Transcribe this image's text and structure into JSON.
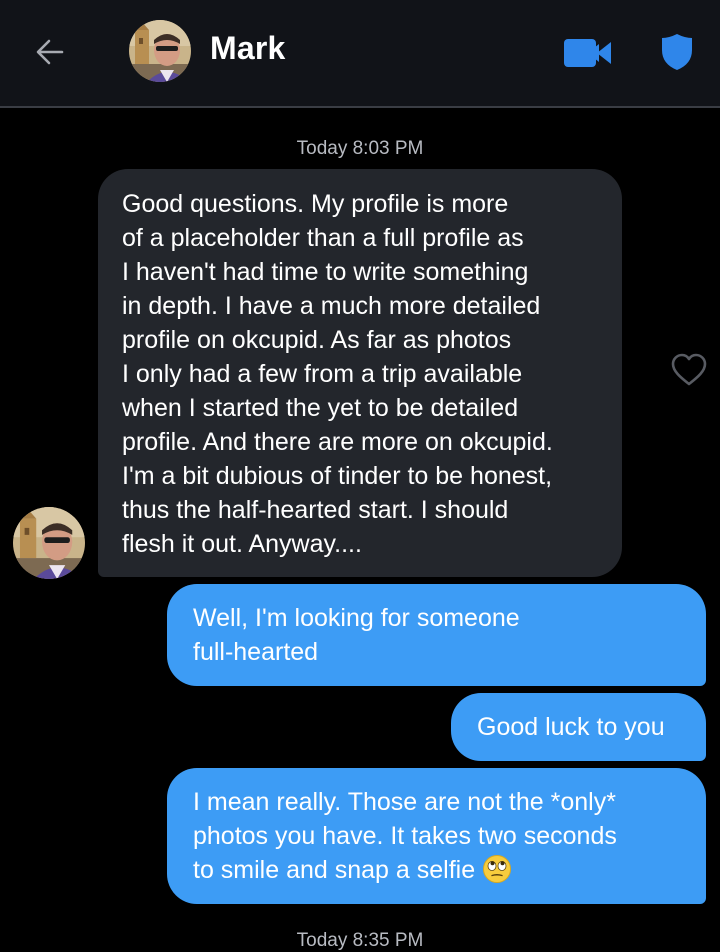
{
  "header": {
    "contact_name": "Mark",
    "back_icon": "arrow-left-icon",
    "video_icon": "video-camera-icon",
    "safety_icon": "shield-icon",
    "accent_color": "#2f86ea"
  },
  "conversation": {
    "timestamp_top": "Today 8:03 PM",
    "timestamp_bottom": "Today 8:35 PM",
    "messages": [
      {
        "direction": "incoming",
        "text": "Good questions. My profile is more\nof a placeholder than a full profile as\nI haven't had time to write something\nin depth. I have a much more detailed\nprofile on okcupid. As far as photos\nI only had a few from a trip available\nwhen I started the yet to be detailed\nprofile. And there are more on okcupid.\nI'm a bit dubious of tinder to be honest,\nthus the half-hearted start. I should\nflesh it out. Anyway...."
      },
      {
        "direction": "outgoing",
        "text": "Well, I'm looking for someone\nfull-hearted"
      },
      {
        "direction": "outgoing",
        "text": "Good luck to you"
      },
      {
        "direction": "outgoing",
        "text": "I mean really. Those are not the *only*\nphotos you have. It takes two seconds\nto smile and snap a selfie",
        "emoji": "eye-roll-emoji-icon"
      }
    ],
    "like_icon": "heart-outline-icon",
    "incoming_bubble_color": "#23262c",
    "outgoing_bubble_color": "#3d9cf5"
  }
}
